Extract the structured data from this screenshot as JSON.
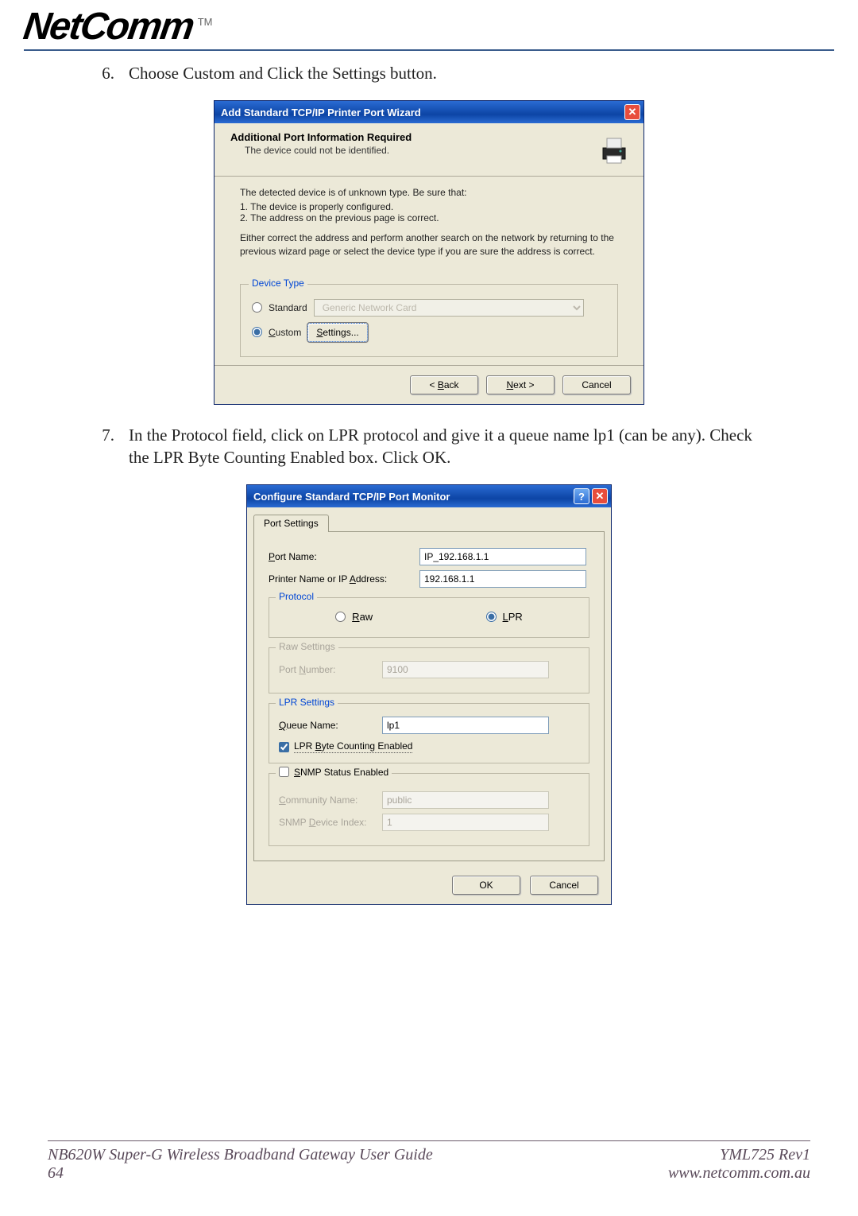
{
  "header": {
    "brand": "NetComm",
    "tm": "TM"
  },
  "steps": {
    "6": {
      "num": "6.",
      "text": "Choose Custom and Click the Settings button."
    },
    "7": {
      "num": "7.",
      "text": "In the Protocol field, click on LPR protocol and give it a queue name lp1 (can be any). Check the LPR Byte Counting Enabled box. Click OK."
    }
  },
  "wizard": {
    "title": "Add Standard TCP/IP Printer Port Wizard",
    "header_bold": "Additional Port Information Required",
    "header_sub": "The device could not be identified.",
    "paragraph1_intro": "The detected device is of unknown type.  Be sure that:",
    "paragraph1_l1": "1. The device is properly configured.",
    "paragraph1_l2": "2. The address on the previous page is correct.",
    "paragraph2": "Either correct the address and perform another search on the network by returning to the previous wizard page or select the device type if you are sure the address is correct.",
    "group_label": "Device Type",
    "radio_standard": "Standard",
    "radio_custom_pre": "C",
    "radio_custom_rest": "ustom",
    "standard_option": "Generic Network Card",
    "settings_btn_pre": "S",
    "settings_btn_rest": "ettings...",
    "back_pre": "< ",
    "back_u": "B",
    "back_rest": "ack",
    "next_u": "N",
    "next_rest": "ext >",
    "cancel": "Cancel"
  },
  "monitor": {
    "title": "Configure Standard TCP/IP Port Monitor",
    "tab": "Port Settings",
    "port_name_lbl_u": "P",
    "port_name_lbl_rest": "ort Name:",
    "port_name_val": "IP_192.168.1.1",
    "printer_addr_lbl": "Printer Name or IP ",
    "printer_addr_lbl_u": "A",
    "printer_addr_lbl_rest": "ddress:",
    "printer_addr_val": "192.168.1.1",
    "protocol_legend": "Protocol",
    "raw_u": "R",
    "raw_rest": "aw",
    "lpr_u": "L",
    "lpr_rest": "PR",
    "raw_settings_legend": "Raw Settings",
    "port_number_lbl": "Port ",
    "port_number_lbl_u": "N",
    "port_number_lbl_rest": "umber:",
    "port_number_val": "9100",
    "lpr_settings_legend": "LPR Settings",
    "queue_lbl_u": "Q",
    "queue_lbl_rest": "ueue Name:",
    "queue_val": "lp1",
    "lpr_byte_pre": "LPR ",
    "lpr_byte_u": "B",
    "lpr_byte_rest": "yte Counting Enabled",
    "snmp_status_u": "S",
    "snmp_status_rest": "NMP Status Enabled",
    "community_lbl_u": "C",
    "community_lbl_rest": "ommunity Name:",
    "community_val": "public",
    "snmp_index_lbl": "SNMP ",
    "snmp_index_lbl_u": "D",
    "snmp_index_lbl_rest": "evice Index:",
    "snmp_index_val": "1",
    "ok": "OK",
    "cancel": "Cancel"
  },
  "footer": {
    "left_line1": "NB620W Super-G Wireless Broadband  Gateway User Guide",
    "left_line2": "64",
    "right_line1": "YML725 Rev1",
    "right_line2": "www.netcomm.com.au"
  }
}
